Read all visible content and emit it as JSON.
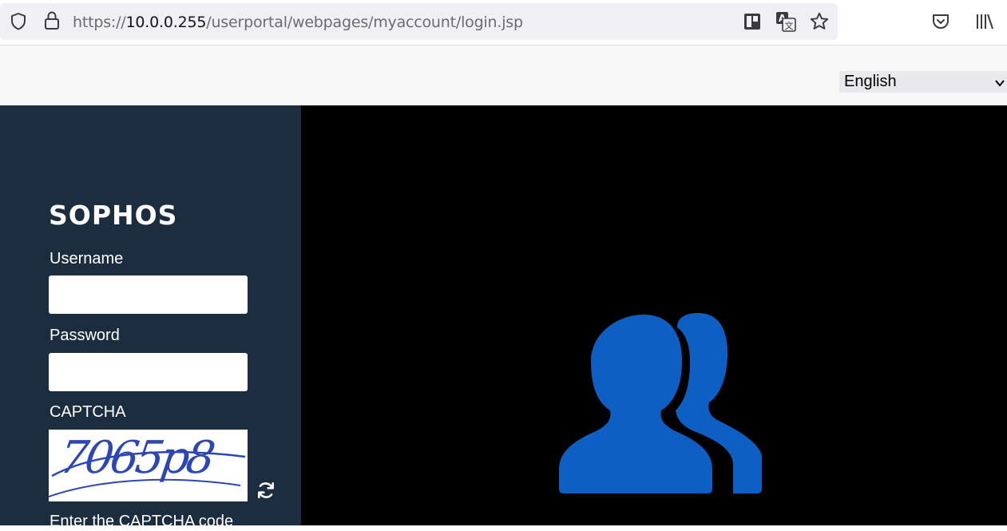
{
  "browser": {
    "url_prefix": "https://",
    "url_host": "10.0.0.255",
    "url_path": "/userportal/webpages/myaccount/login.jsp",
    "icons": [
      "shield-icon",
      "lock-icon",
      "reader-view-icon",
      "translate-icon",
      "bookmark-star-icon",
      "pocket-icon",
      "library-icon"
    ]
  },
  "language": {
    "selected": "English"
  },
  "login": {
    "brand": "SOPHOS",
    "username_label": "Username",
    "username_value": "",
    "password_label": "Password",
    "password_value": "",
    "captcha_label": "CAPTCHA",
    "captcha_image_text": "7065p8",
    "captcha_hint": "Enter the CAPTCHA code"
  },
  "colors": {
    "panel_bg": "#1b2d3e",
    "hero_bg": "#000000",
    "users_icon": "#0d5fc4",
    "captcha_ink": "#2c47b3"
  }
}
